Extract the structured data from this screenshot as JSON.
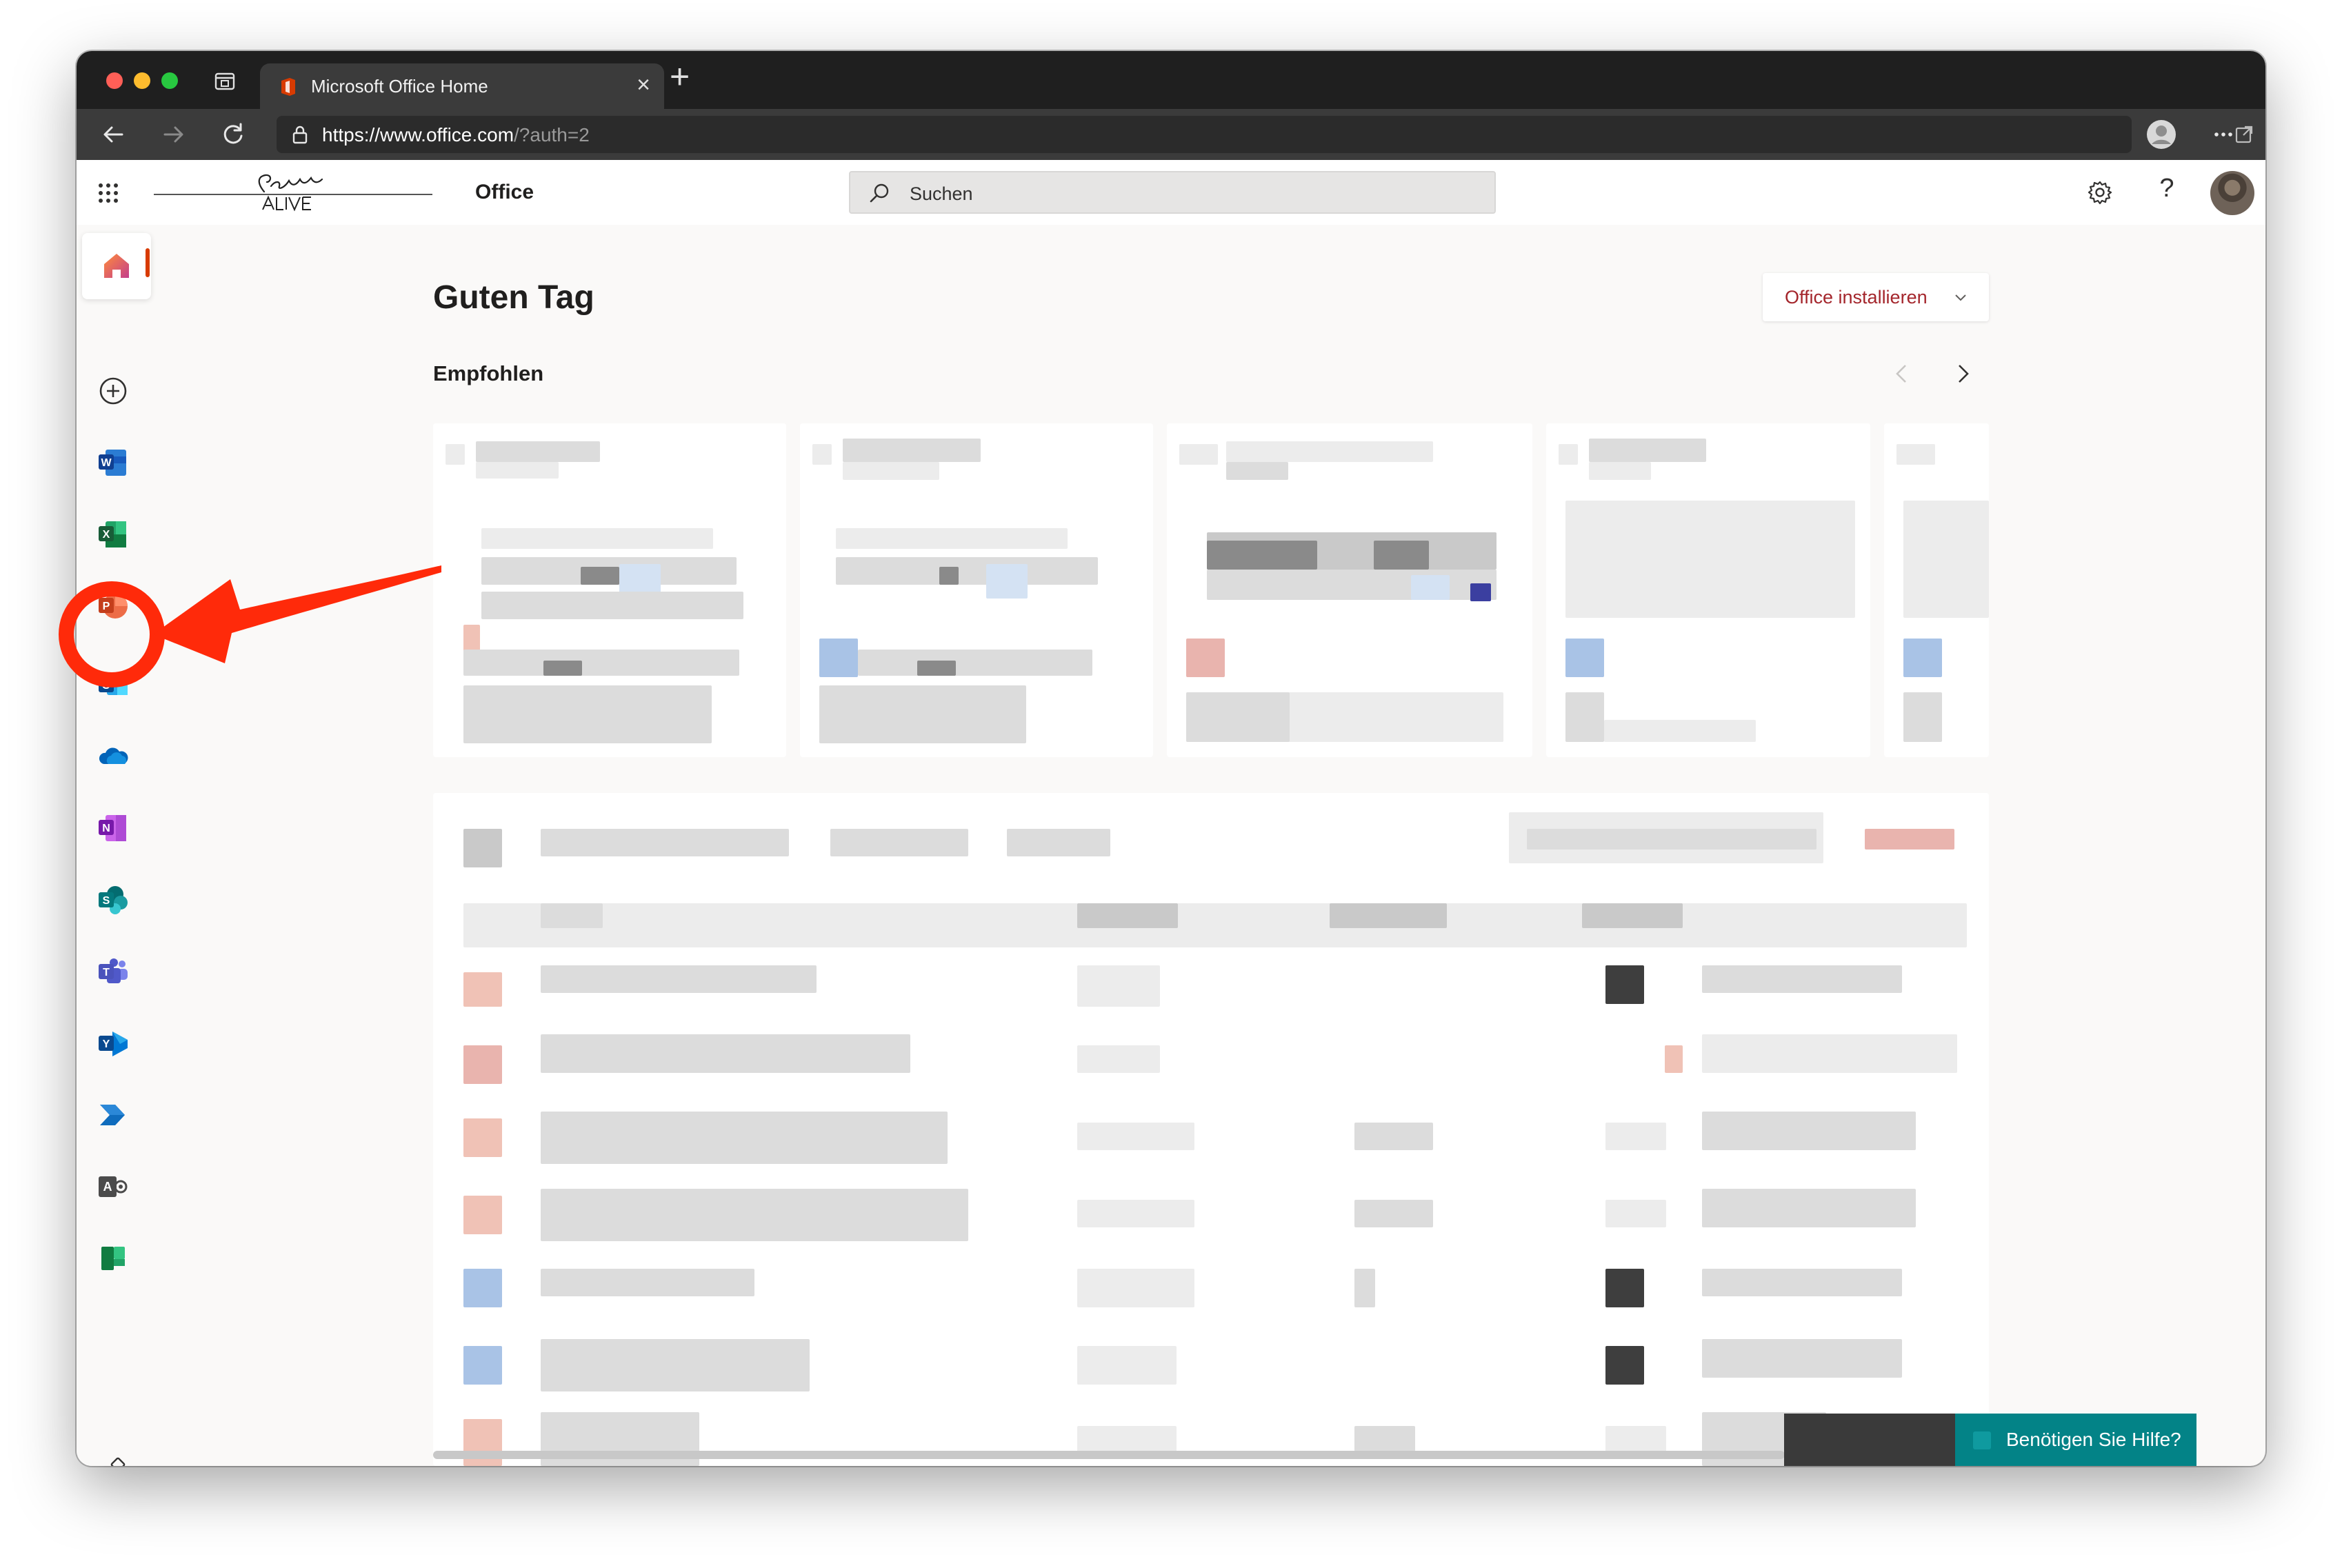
{
  "browser": {
    "tab_title": "Microsoft Office Home",
    "tab_close": "×",
    "new_tab": "+",
    "url_main": "https://www.office.com",
    "url_rest": "/?auth=2"
  },
  "header": {
    "brand": "Office",
    "search_placeholder": "Suchen",
    "help_glyph": "?"
  },
  "main": {
    "greeting": "Guten Tag",
    "install_button": "Office installieren",
    "recommended_title": "Empfohlen"
  },
  "help_button": "Benötigen Sie Hilfe?",
  "colors": {
    "accent": "#d83b01",
    "install_text": "#a4262c",
    "help_bg": "#038387",
    "annotation": "#ff2a0a"
  },
  "rail_apps": [
    "home-icon",
    "create-icon",
    "word-icon",
    "excel-icon",
    "powerpoint-icon",
    "outlook-icon",
    "onedrive-icon",
    "onenote-icon",
    "sharepoint-icon",
    "teams-icon",
    "yammer-icon",
    "power-automate-icon",
    "admin-icon",
    "planner-icon",
    "all-apps-icon"
  ]
}
